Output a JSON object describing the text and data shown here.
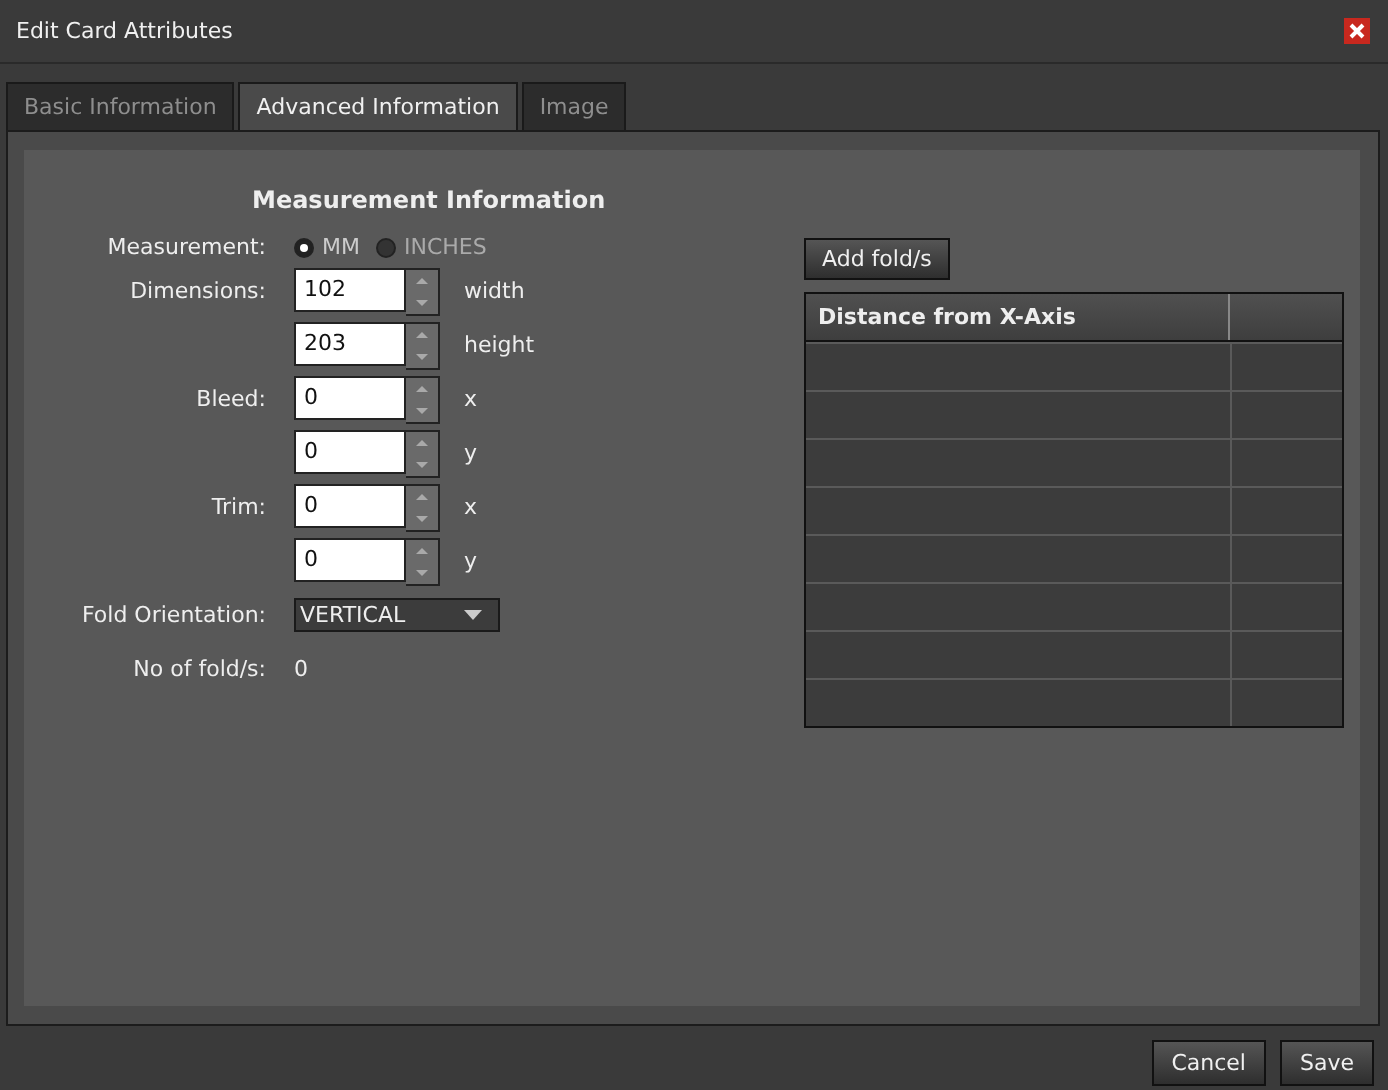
{
  "window": {
    "title": "Edit Card Attributes"
  },
  "tabs": [
    {
      "label": "Basic Information",
      "selected": false
    },
    {
      "label": "Advanced Information",
      "selected": true
    },
    {
      "label": "Image",
      "selected": false
    }
  ],
  "section_title": "Measurement Information",
  "measurement": {
    "label": "Measurement:",
    "options": [
      {
        "label": "MM",
        "selected": true
      },
      {
        "label": "INCHES",
        "selected": false
      }
    ]
  },
  "fields": [
    {
      "label": "Dimensions:",
      "value": "102",
      "unit": "width"
    },
    {
      "value": "203",
      "unit": "height"
    },
    {
      "label": "Bleed:",
      "value": "0",
      "unit": "x"
    },
    {
      "value": "0",
      "unit": "y"
    },
    {
      "label": "Trim:",
      "value": "0",
      "unit": "x"
    },
    {
      "value": "0",
      "unit": "y"
    }
  ],
  "fold_orientation": {
    "label": "Fold Orientation:",
    "value": "VERTICAL"
  },
  "fold_count": {
    "label": "No of fold/s:",
    "value": "0"
  },
  "add_button": "Add fold/s",
  "table": {
    "columns": [
      "Distance from X-Axis"
    ]
  },
  "buttons": [
    "Cancel",
    "Save"
  ]
}
